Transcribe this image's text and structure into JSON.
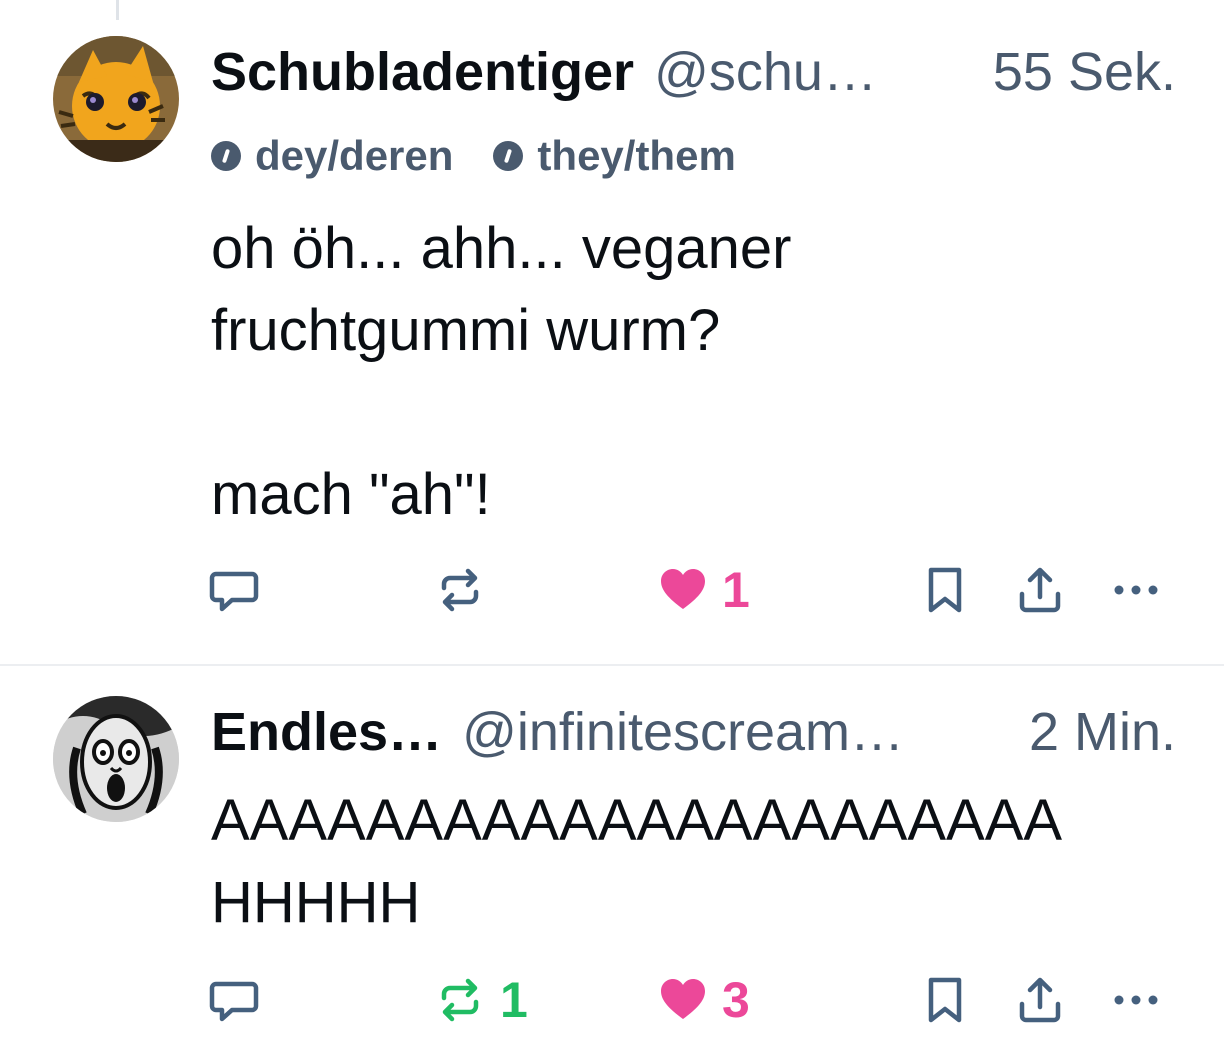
{
  "posts": [
    {
      "display_name": "Schubladentiger",
      "handle": "@schu…",
      "time": "55 Sek.",
      "pronouns": [
        "dey/deren",
        "they/them"
      ],
      "text": "oh öh... ahh... veganer\nfruchtgummi wurm?\n\nmach \"ah\"!",
      "avatar_icon": "orange-cat-avatar",
      "reply_count": "",
      "repost_count": "",
      "like_count": "1",
      "liked": true,
      "reposted": false
    },
    {
      "display_name": "Endles…",
      "handle": "@infinitescream…",
      "time": "2 Min.",
      "pronouns": [],
      "text": "AAAAAAAAAAAAAAAAAAAAAA\nHHHHH",
      "avatar_icon": "scream-painting-avatar",
      "reply_count": "",
      "repost_count": "1",
      "like_count": "3",
      "liked": true,
      "reposted": true
    }
  ],
  "colors": {
    "text": "#0b0f14",
    "muted": "#4a5a6e",
    "icon": "#45607e",
    "like": "#ec4899",
    "repost": "#20bc63",
    "divider": "#eceef1"
  },
  "icons": {
    "reply": "speech-bubble-icon",
    "repost": "repost-arrows-icon",
    "like": "heart-icon",
    "bookmark": "bookmark-icon",
    "share": "share-icon",
    "more": "more-dots-icon",
    "pronoun": "info-icon"
  }
}
